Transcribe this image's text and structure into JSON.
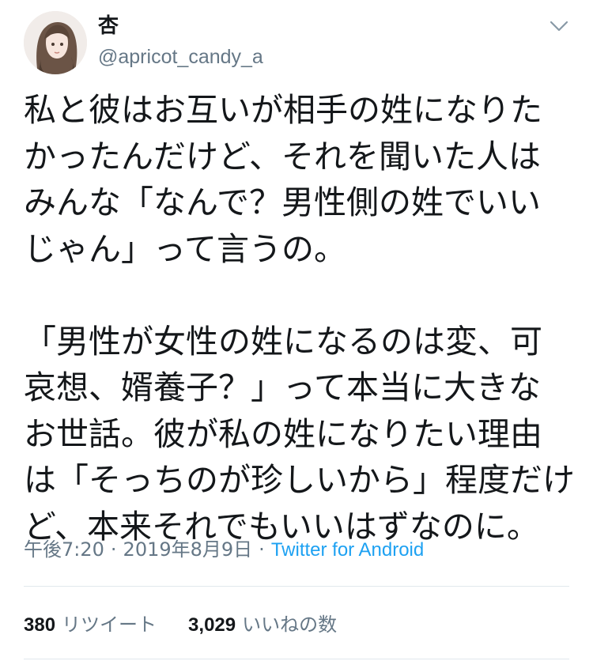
{
  "user": {
    "display_name": "杏",
    "handle": "@apricot_candy_a"
  },
  "tweet": {
    "lines": [
      "私と彼はお互いが相手の姓になりた",
      "かったんだけど、それを聞いた人は",
      "みんな「なんで？男性側の姓でいい",
      "じゃん」って言うの。",
      "",
      "「男性が女性の姓になるのは変、可",
      "哀想、婿養子？」って本当に大きな",
      "お世話。彼が私の姓になりたい理由",
      "は「そっちのが珍しいから」程度だけ",
      "ど、本来それでもいいはずなのに。"
    ]
  },
  "meta": {
    "time": "午後7:20",
    "separator": "·",
    "date": "2019年8月9日",
    "source": "Twitter for Android"
  },
  "stats": {
    "retweet_count": "380",
    "retweet_label": "リツイート",
    "like_count": "3,029",
    "like_label": "いいねの数"
  },
  "icons": {
    "menu": "chevron-down-icon"
  },
  "colors": {
    "text": "#14171a",
    "secondary": "#657786",
    "link": "#1da1f2",
    "divider": "#e1e8ed"
  }
}
